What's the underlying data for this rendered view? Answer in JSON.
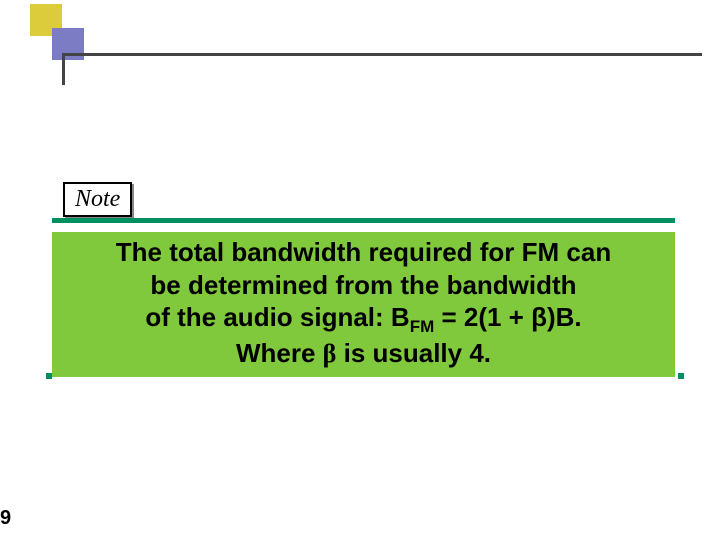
{
  "note": {
    "label": "Note"
  },
  "content": {
    "line1": "The total bandwidth required for FM can",
    "line2": "be determined from the bandwidth",
    "line3_prefix": "of the audio signal: B",
    "line3_sub": "FM",
    "line3_suffix": " = 2(1 + β)B.",
    "line4_prefix": "Where ",
    "line4_beta": "β",
    "line4_suffix": " is usually 4."
  },
  "page": {
    "number": "9"
  }
}
